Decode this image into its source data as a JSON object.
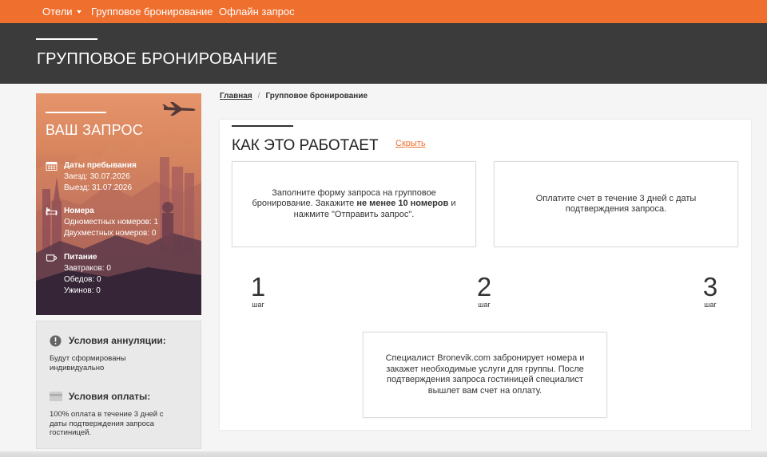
{
  "nav": {
    "items": [
      {
        "label": "Отели",
        "has_dropdown": true
      },
      {
        "label": "Групповое бронирование",
        "has_dropdown": false
      },
      {
        "label": "Офлайн запрос",
        "has_dropdown": false
      }
    ]
  },
  "hero": {
    "title": "ГРУППОВОЕ БРОНИРОВАНИЕ"
  },
  "request": {
    "title": "ВАШ ЗАПРОС",
    "dates": {
      "icon": "calendar-icon",
      "heading": "Даты пребывания",
      "checkin": "Заезд: 30.07.2026",
      "checkout": "Выезд: 31.07.2026"
    },
    "rooms": {
      "icon": "bed-icon",
      "heading": "Номера",
      "single": "Одноместных номеров: 1",
      "double": "Двухместных номеров: 0"
    },
    "meals": {
      "icon": "cup-icon",
      "heading": "Питание",
      "breakfasts": "Завтраков: 0",
      "lunches": "Обедов: 0",
      "dinners": "Ужинов: 0"
    }
  },
  "conditions": {
    "cancellation": {
      "icon": "info-icon",
      "heading": "Условия аннуляции:",
      "line1": "Будут сформированы",
      "line2": "индивидуально"
    },
    "payment": {
      "icon": "credit-card-icon",
      "heading": "Условия оплаты:",
      "line1": "100% оплата в течение 3 дней с",
      "line2": "даты подтверждения запроса",
      "line3": "гостиницей."
    }
  },
  "breadcrumb": {
    "home": "Главная",
    "separator": "/",
    "current": "Групповое бронирование"
  },
  "how": {
    "title": "КАК ЭТО РАБОТАЕТ",
    "hide_label": "Скрыть",
    "step1": {
      "line1": "Заполните форму запроса на групповое",
      "line2_pre": "бронирование. Закажите ",
      "line2_bold": "не менее 10 номеров",
      "line2_post": " и",
      "line3": "нажмите \"Отправить запрос\"."
    },
    "step2": {
      "line1": "Оплатите счет в течение 3 дней с даты",
      "line2": "подтверждения запроса."
    },
    "step3": {
      "line1": "Специалист Bronevik.com забронирует номера и",
      "line2": "закажет необходимые услуги для группы. После",
      "line3": "подтверждения запроса гостиницей специалист",
      "line4": "вышлет вам счет на оплату."
    },
    "numbers": [
      {
        "n": "1",
        "word": "шаг"
      },
      {
        "n": "2",
        "word": "шаг"
      },
      {
        "n": "3",
        "word": "шаг"
      }
    ]
  },
  "colors": {
    "accent": "#ef6f2e",
    "hero_bg": "#3b3b3b"
  }
}
